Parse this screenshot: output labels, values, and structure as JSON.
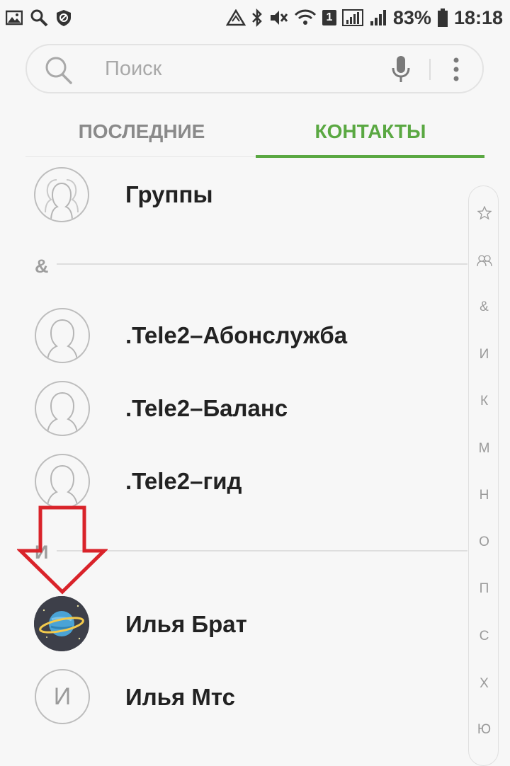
{
  "status_bar": {
    "battery": "83%",
    "time": "18:18",
    "sim_slot": "1"
  },
  "search": {
    "placeholder": "Поиск"
  },
  "tabs": [
    {
      "label": "ПОСЛЕДНИЕ",
      "active": false
    },
    {
      "label": "КОНТАКТЫ",
      "active": true
    }
  ],
  "contacts": {
    "groups_label": "Группы",
    "sections": [
      {
        "letter": "&",
        "items": [
          {
            "name": ".Tele2–Абонслужба",
            "avatar": "person-icon"
          },
          {
            "name": ".Tele2–Баланс",
            "avatar": "person-icon"
          },
          {
            "name": ".Tele2–гид",
            "avatar": "person-icon"
          }
        ]
      },
      {
        "letter": "И",
        "items": [
          {
            "name": "Илья Брат",
            "avatar": "planet-icon"
          },
          {
            "name": "Илья Мтс",
            "avatar": "letter",
            "avatar_letter": "И"
          }
        ]
      }
    ]
  },
  "index_scroller": [
    "☆",
    "👥",
    "&",
    "И",
    "К",
    "М",
    "Н",
    "О",
    "П",
    "С",
    "Х",
    "Ю"
  ],
  "colors": {
    "accent": "#5aa842",
    "annotation": "#d9232a",
    "background": "#f7f7f7"
  }
}
